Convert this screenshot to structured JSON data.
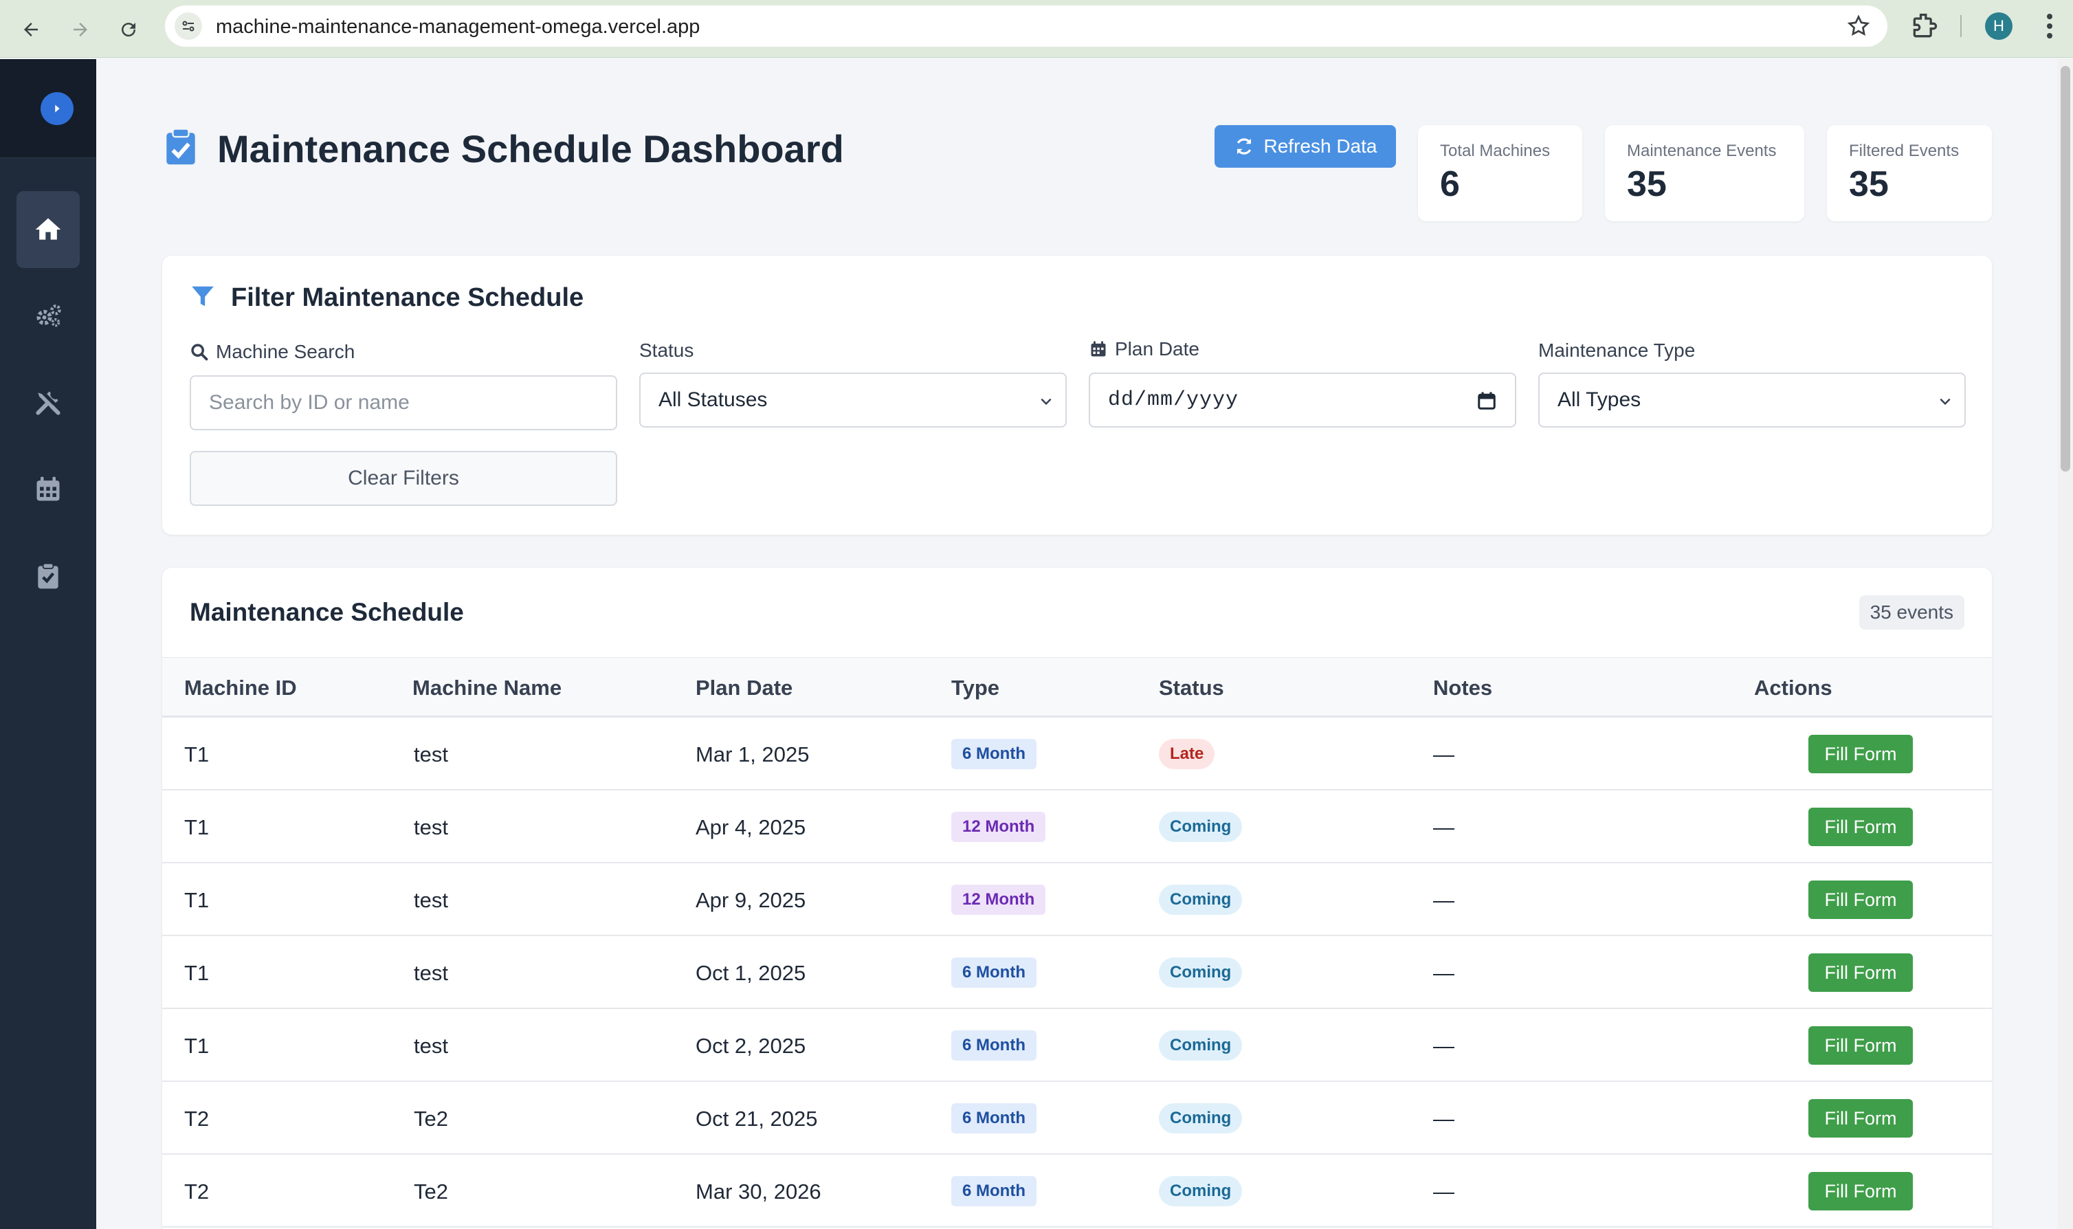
{
  "browser": {
    "url": "machine-maintenance-management-omega.vercel.app",
    "profile_initial": "H"
  },
  "sidebar": {
    "items": [
      {
        "icon": "home-icon",
        "active": true
      },
      {
        "icon": "gears-icon",
        "active": false
      },
      {
        "icon": "tools-icon",
        "active": false
      },
      {
        "icon": "calendar-icon",
        "active": false
      },
      {
        "icon": "clipboard-check-icon",
        "active": false
      }
    ]
  },
  "header": {
    "title": "Maintenance Schedule Dashboard",
    "refresh_label": "Refresh Data",
    "stats": [
      {
        "label": "Total Machines",
        "value": "6"
      },
      {
        "label": "Maintenance Events",
        "value": "35"
      },
      {
        "label": "Filtered Events",
        "value": "35"
      }
    ]
  },
  "filters": {
    "title": "Filter Maintenance Schedule",
    "machine_search": {
      "label": "Machine Search",
      "placeholder": "Search by ID or name"
    },
    "status": {
      "label": "Status",
      "value": "All Statuses"
    },
    "plan_date": {
      "label": "Plan Date",
      "placeholder": "dd/mm/yyyy"
    },
    "maintenance_type": {
      "label": "Maintenance Type",
      "value": "All Types"
    },
    "clear_label": "Clear Filters"
  },
  "schedule": {
    "title": "Maintenance Schedule",
    "count_label": "35 events",
    "columns": [
      "Machine ID",
      "Machine Name",
      "Plan Date",
      "Type",
      "Status",
      "Notes",
      "Actions"
    ],
    "rows": [
      {
        "id": "T1",
        "name": "test",
        "date": "Mar 1, 2025",
        "type": "6 Month",
        "status": "Late",
        "notes": "—",
        "action": "Fill Form"
      },
      {
        "id": "T1",
        "name": "test",
        "date": "Apr 4, 2025",
        "type": "12 Month",
        "status": "Coming",
        "notes": "—",
        "action": "Fill Form"
      },
      {
        "id": "T1",
        "name": "test",
        "date": "Apr 9, 2025",
        "type": "12 Month",
        "status": "Coming",
        "notes": "—",
        "action": "Fill Form"
      },
      {
        "id": "T1",
        "name": "test",
        "date": "Oct 1, 2025",
        "type": "6 Month",
        "status": "Coming",
        "notes": "—",
        "action": "Fill Form"
      },
      {
        "id": "T1",
        "name": "test",
        "date": "Oct 2, 2025",
        "type": "6 Month",
        "status": "Coming",
        "notes": "—",
        "action": "Fill Form"
      },
      {
        "id": "T2",
        "name": "Te2",
        "date": "Oct 21, 2025",
        "type": "6 Month",
        "status": "Coming",
        "notes": "—",
        "action": "Fill Form"
      },
      {
        "id": "T2",
        "name": "Te2",
        "date": "Mar 30, 2026",
        "type": "6 Month",
        "status": "Coming",
        "notes": "—",
        "action": "Fill Form"
      }
    ]
  },
  "colors": {
    "sidebar": "#1f2a3a",
    "accent": "#4a90e2",
    "fill_button": "#3f9e4a"
  }
}
